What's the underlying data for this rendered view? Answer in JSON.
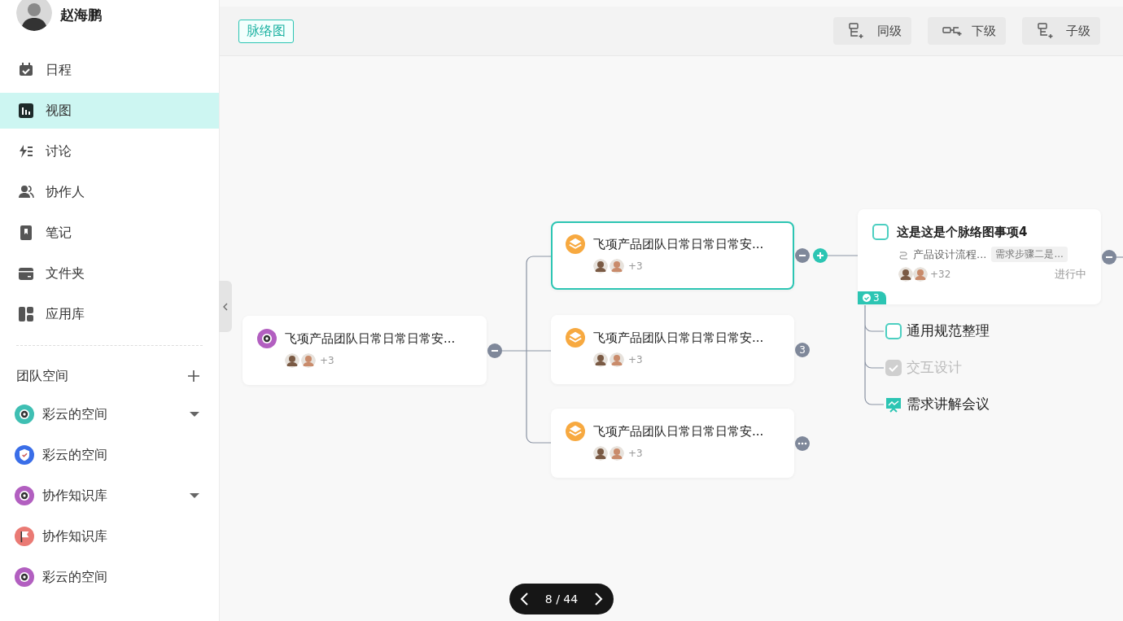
{
  "user": {
    "name": "赵海鹏"
  },
  "nav": [
    {
      "label": "日程",
      "selected": false
    },
    {
      "label": "视图",
      "selected": true
    },
    {
      "label": "讨论",
      "selected": false
    },
    {
      "label": "协作人",
      "selected": false
    },
    {
      "label": "笔记",
      "selected": false
    },
    {
      "label": "文件夹",
      "selected": false
    },
    {
      "label": "应用库",
      "selected": false
    }
  ],
  "team": {
    "title": "团队空间",
    "spaces": [
      {
        "name": "彩云的空间",
        "color": "#3fbfb3",
        "expandable": true
      },
      {
        "name": "彩云的空间",
        "color": "#3a6ee8",
        "expandable": false
      },
      {
        "name": "协作知识库",
        "color": "#b25fc0",
        "expandable": true
      },
      {
        "name": "协作知识库",
        "color": "#ea7a74",
        "expandable": false
      },
      {
        "name": "彩云的空间",
        "color": "#b25fc0",
        "expandable": false
      }
    ]
  },
  "toolbar": {
    "view_tag": "脉络图",
    "buttons": [
      {
        "label": "同级"
      },
      {
        "label": "下级"
      },
      {
        "label": "子级"
      }
    ]
  },
  "map": {
    "root": {
      "title": "飞项产品团队日常日常日常安...",
      "color": "#b25fc0",
      "more": "+3",
      "selected": false,
      "handle": {
        "kind": "collapse"
      }
    },
    "branches": [
      {
        "title": "飞项产品团队日常日常日常安...",
        "color": "#f7a940",
        "more": "+3",
        "selected": true,
        "handle": {
          "kind": "collapse"
        }
      },
      {
        "title": "飞项产品团队日常日常日常安...",
        "color": "#f7a940",
        "more": "+3",
        "selected": false,
        "handle": {
          "kind": "count",
          "text": "3"
        }
      },
      {
        "title": "飞项产品团队日常日常日常安...",
        "color": "#f7a940",
        "more": "+3",
        "selected": false,
        "handle": {
          "kind": "more"
        }
      }
    ],
    "task": {
      "title": "这是这是个脉络图事项4",
      "checked": false,
      "path": "产品设计流程...",
      "tag": "需求步骤二是...",
      "more": "+32",
      "status": "进行中",
      "subtask_count": "3",
      "handle": {
        "kind": "collapse"
      },
      "subtasks": [
        {
          "kind": "task",
          "label": "通用规范整理",
          "checked": false
        },
        {
          "kind": "task",
          "label": "交互设计",
          "checked": true
        },
        {
          "kind": "meeting",
          "label": "需求讲解会议"
        }
      ]
    }
  },
  "pager": {
    "text": "8 / 44"
  }
}
